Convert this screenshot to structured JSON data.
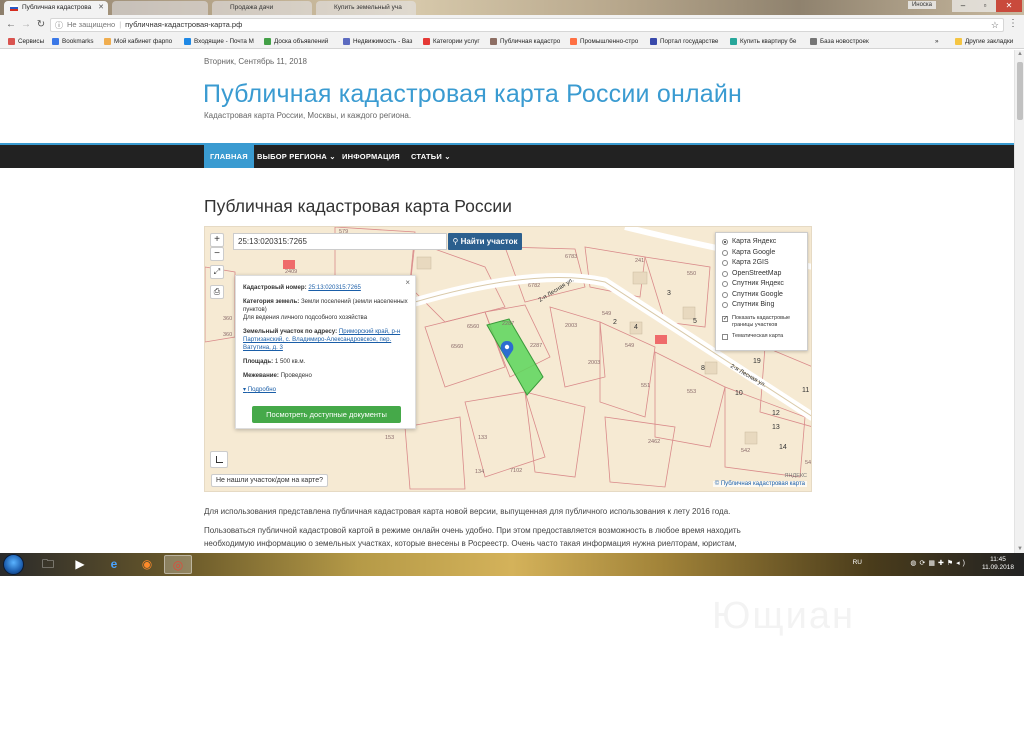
{
  "browser": {
    "tabs": [
      {
        "label": "Публичная кадастрова",
        "active": true
      },
      {
        "label": "",
        "active": false
      },
      {
        "label": "Продажа дачи",
        "active": false
      },
      {
        "label": "Купить земельный уча",
        "active": false
      }
    ],
    "user_chip": "Иноска",
    "address_security": "Не защищено",
    "address_url": "публичная-кадастровая-карта.рф"
  },
  "bookmarks": [
    {
      "label": "Сервисы",
      "color": "#d9534f"
    },
    {
      "label": "Bookmarks",
      "color": "#3b78e7"
    },
    {
      "label": "Мой кабинет фарпо",
      "color": "#f0ad4e"
    },
    {
      "label": "Входящие - Почта M",
      "color": "#1e88e5"
    },
    {
      "label": "Доска объявлений",
      "color": "#43a047"
    },
    {
      "label": "Недвижимость - Ваз",
      "color": "#5c6bc0"
    },
    {
      "label": "Категории услуг",
      "color": "#e53935"
    },
    {
      "label": "Публичная кадастро",
      "color": "#8d6e63"
    },
    {
      "label": "Промышленно-стро",
      "color": "#ff7043"
    },
    {
      "label": "Портал государстве",
      "color": "#3949ab"
    },
    {
      "label": "Купить квартиру бе",
      "color": "#26a69a"
    },
    {
      "label": "База новостроек",
      "color": "#757575"
    }
  ],
  "bookmarks_more": "»",
  "bookmarks_other": "Другие закладки",
  "site": {
    "date": "Вторник, Сентябрь 11, 2018",
    "title": "Публичная кадастровая карта России онлайн",
    "description": "Кадастровая карта России, Москвы, и каждого региона.",
    "nav": [
      {
        "label": "ГЛАВНАЯ",
        "current": true
      },
      {
        "label": "ВЫБОР РЕГИОНА ⌄",
        "current": false
      },
      {
        "label": "ИНФОРМАЦИЯ",
        "current": false
      },
      {
        "label": "СТАТЬИ ⌄",
        "current": false
      }
    ],
    "heading": "Публичная кадастровая карта России"
  },
  "map": {
    "search_value": "25:13:020315:7265",
    "find_button": "Найти участок",
    "zoom_in": "+",
    "zoom_out": "−",
    "popup": {
      "cadnum_label": "Кадастровый номер:",
      "cadnum_value": "25:13:020315:7265",
      "category_label": "Категория земель:",
      "category_value": "Земли поселений (земли населенных пунктов)",
      "usage": "Для ведения личного подсобного хозяйства",
      "address_label": "Земельный участок по адресу:",
      "address_value": "Приморский край, р-н Партизанский, с. Владимиро-Александровское, пер. Ватутина, д. 3",
      "area_label": "Площадь:",
      "area_value": "1 500 кв.м.",
      "survey_label": "Межевание:",
      "survey_value": "Проведено",
      "more": "Подробно",
      "docs_button": "Посмотреть доступные документы"
    },
    "layers": [
      {
        "label": "Карта Яндекс",
        "on": true
      },
      {
        "label": "Карта Google",
        "on": false
      },
      {
        "label": "Карта 2GIS",
        "on": false
      },
      {
        "label": "OpenStreetMap",
        "on": false
      },
      {
        "label": "Спутник Яндекс",
        "on": false
      },
      {
        "label": "Спутник Google",
        "on": false
      },
      {
        "label": "Спутник Bing",
        "on": false
      }
    ],
    "show_borders": "Показать кадастровые границы участков",
    "thematic": "Тематическая карта",
    "notfound_button": "Не нашли участок/дом на карте?",
    "credit": "© Публичная кадастровая карта",
    "yandex_mark": "ЯНДЕКС",
    "street_1": "2-я Лесная ул.",
    "street_2": "2-я Лесная ул.",
    "plot_labels": [
      "579",
      "6783",
      "241",
      "550",
      "6782",
      "3",
      "2287",
      "2003",
      "549",
      "2",
      "4",
      "5",
      "6560",
      "6560",
      "2287",
      "549",
      "2003",
      "8",
      "551",
      "553",
      "10",
      "11",
      "12",
      "13",
      "133",
      "2462",
      "14",
      "542",
      "54",
      "7102",
      "134",
      "153",
      "2409",
      "360",
      "360",
      "19"
    ]
  },
  "paragraphs": [
    "Для использования представлена публичная кадастровая карта новой версии, выпущенная для публичного использования к лету 2016 года.",
    "Пользоваться публичной кадастровой картой в режиме онлайн очень удобно. При этом предоставляется возможность в любое время находить необходимую информацию о земельных участках, которые внесены в Росреестр. Очень часто такая информация нужна риелторам, юристам,"
  ],
  "taskbar": {
    "lang": "RU",
    "time": "11:45",
    "date": "11.09.2018"
  },
  "watermark": "Ющиан"
}
